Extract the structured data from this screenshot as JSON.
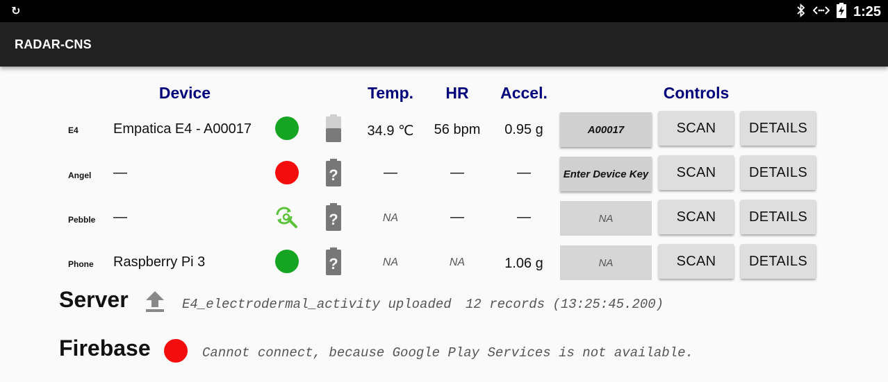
{
  "status_bar": {
    "left_icon": "cast-icon",
    "icons": [
      "bluetooth-icon",
      "data-sync-icon",
      "battery-charging-icon"
    ],
    "time": "1:25"
  },
  "app_bar": {
    "title": "RADAR-CNS"
  },
  "headers": {
    "device": "Device",
    "temp": "Temp.",
    "hr": "HR",
    "accel": "Accel.",
    "controls": "Controls"
  },
  "devices": [
    {
      "label": "E4",
      "name": "Empatica E4 - A00017",
      "status": "connected",
      "status_color": "#16a523",
      "battery": "partial",
      "temp": "34.9 ℃",
      "hr": "56 bpm",
      "accel": "0.95 g",
      "key": "A00017",
      "scan": "SCAN",
      "details": "DETAILS"
    },
    {
      "label": "Angel",
      "name": "—",
      "status": "disconnected",
      "status_color": "#f50d0d",
      "battery": "unknown",
      "temp": "—",
      "hr": "—",
      "accel": "—",
      "key": "Enter Device Key",
      "scan": "SCAN",
      "details": "DETAILS"
    },
    {
      "label": "Pebble",
      "name": "—",
      "status": "searching",
      "status_color": "#5cc23a",
      "battery": "unknown",
      "temp": "NA",
      "hr": "—",
      "accel": "—",
      "key": "NA",
      "scan": "SCAN",
      "details": "DETAILS"
    },
    {
      "label": "Phone",
      "name": "Raspberry Pi 3",
      "status": "connected",
      "status_color": "#16a523",
      "battery": "unknown",
      "temp": "NA",
      "hr": "NA",
      "accel": "1.06 g",
      "key": "NA",
      "scan": "SCAN",
      "details": "DETAILS"
    }
  ],
  "server": {
    "title": "Server",
    "icon": "upload-icon",
    "message": "E4_electrodermal_activity uploaded",
    "records": "12 records (13:25:45.200)"
  },
  "firebase": {
    "title": "Firebase",
    "status_color": "#f50d0d",
    "message": "Cannot connect, because Google Play Services is not available."
  }
}
